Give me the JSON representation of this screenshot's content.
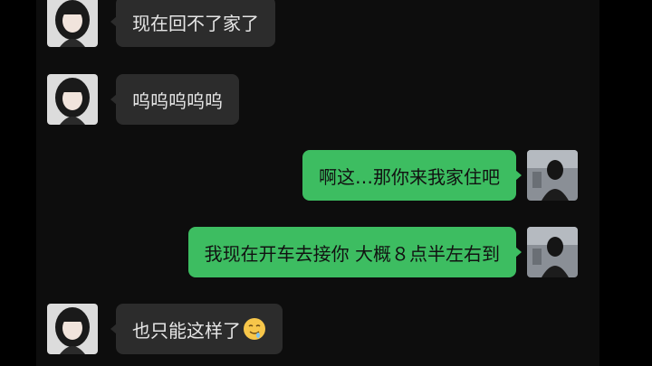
{
  "messages": [
    {
      "side": "received",
      "text": "现在回不了家了",
      "avatar": "girl-avatar"
    },
    {
      "side": "received",
      "text": "呜呜呜呜呜",
      "avatar": "girl-avatar"
    },
    {
      "side": "sent",
      "text": "啊这…那你来我家住吧",
      "avatar": "boy-avatar"
    },
    {
      "side": "sent",
      "text": "我现在开车去接你 大概８点半左右到",
      "avatar": "boy-avatar"
    },
    {
      "side": "received",
      "text": "也只能这样了",
      "emoji": "drooling-face-emoji",
      "avatar": "girl-avatar"
    }
  ],
  "colors": {
    "background": "#000000",
    "chat_background": "#0d0d0d",
    "received_bubble": "#2c2c2c",
    "sent_bubble": "#3dbd61",
    "received_text": "#e6e6e6",
    "sent_text": "#111111"
  }
}
